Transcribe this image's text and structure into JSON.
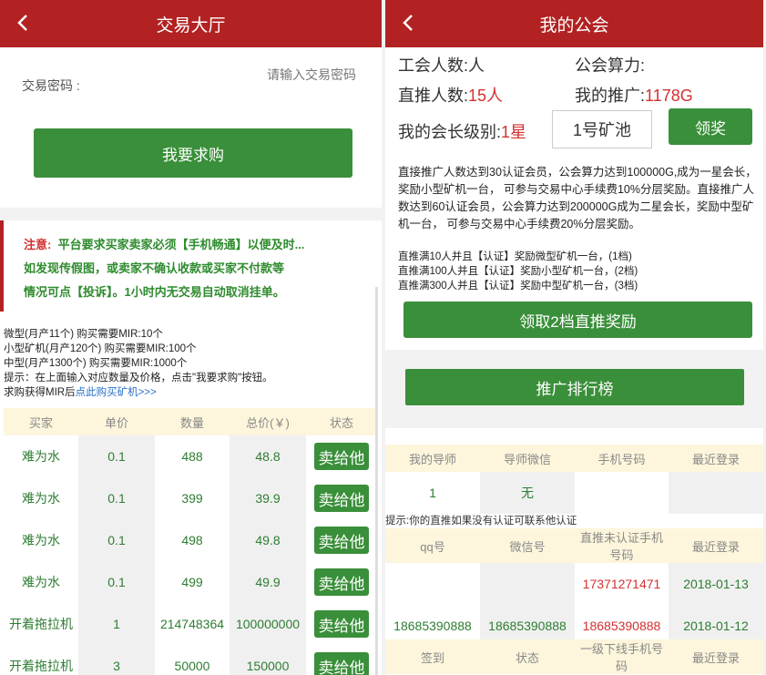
{
  "left": {
    "title": "交易大厅",
    "password_label": "交易密码 :",
    "password_placeholder": "请输入交易密码",
    "buy_button": "我要求购",
    "notice_title": "注意:",
    "notice_text": "平台要求买家卖家必须【手机畅通】以便及时...",
    "notice_line2": "如发现传假图，或卖家不确认收款或买家不付款等",
    "notice_line3": "情况可点【投诉】。1小时内无交易自动取消挂单。",
    "info_lines": [
      "微型(月产11个) 购买需要MIR:10个",
      "小型矿机(月产120个) 购买需要MIR:100个",
      "中型(月产1300个) 购买需要MIR:1000个",
      "提示：在上面输入对应数量及价格，点击\"我要求购\"按钮。"
    ],
    "info_last_prefix": "求购获得MIR后",
    "info_link": "点此购买矿机>>>",
    "table_headers": [
      "买家",
      "单价",
      "数量",
      "总价(￥)",
      "状态"
    ],
    "rows": [
      {
        "buyer": "难为水",
        "price": "0.1",
        "qty": "488",
        "total": "48.8",
        "action": "卖给他"
      },
      {
        "buyer": "难为水",
        "price": "0.1",
        "qty": "399",
        "total": "39.9",
        "action": "卖给他"
      },
      {
        "buyer": "难为水",
        "price": "0.1",
        "qty": "498",
        "total": "49.8",
        "action": "卖给他"
      },
      {
        "buyer": "难为水",
        "price": "0.1",
        "qty": "499",
        "total": "49.9",
        "action": "卖给他"
      },
      {
        "buyer": "开着拖拉机",
        "price": "1",
        "qty": "214748364",
        "total": "100000000",
        "action": "卖给他"
      },
      {
        "buyer": "开着拖拉机",
        "price": "3",
        "qty": "50000",
        "total": "150000",
        "action": "卖给他"
      }
    ]
  },
  "right": {
    "title": "我的公会",
    "guild_members_label": "工会人数:",
    "guild_members_value": "人",
    "guild_power_label": "公会算力:",
    "direct_label": "直推人数:",
    "direct_value": "15人",
    "promo_label": "我的推广:",
    "promo_value": "1178G",
    "level_label": "我的会长级别:",
    "level_value": "1星",
    "pool": "1号矿池",
    "award_button": "领奖",
    "desc": "直接推广人数达到30认证会员，公会算力达到100000G,成为一星会长，奖励小型矿机一台， 可参与交易中心手续费10%分层奖励。直接推广人数达到60认证会员，公会算力达到200000G成为二星会长，奖励中型矿机一台， 可参与交易中心手续费20%分层奖励。",
    "tiers": [
      "直推满10人并且【认证】奖励微型矿机一台，(1档)",
      "直推满100人并且【认证】奖励小型矿机一台，(2档)",
      "直推满300人并且【认证】奖励中型矿机一台，(3档)"
    ],
    "claim_button": "领取2档直推奖励",
    "rank_button": "推广排行榜",
    "mentor_headers": [
      "我的导师",
      "导师微信",
      "手机号码",
      "最近登录"
    ],
    "mentor_row": [
      "1",
      "无",
      "",
      ""
    ],
    "hint": "提示:你的直推如果没有认证可联系他认证",
    "direct_headers": [
      "qq号",
      "微信号",
      "直推未认证手机号码",
      "最近登录"
    ],
    "direct_rows": [
      [
        "",
        "",
        "17371271471",
        "2018-01-13"
      ],
      [
        "18685390888",
        "18685390888",
        "18685390888",
        "2018-01-12"
      ]
    ],
    "sign_headers": [
      "签到",
      "状态",
      "一级下线手机号码",
      "最近登录"
    ]
  }
}
